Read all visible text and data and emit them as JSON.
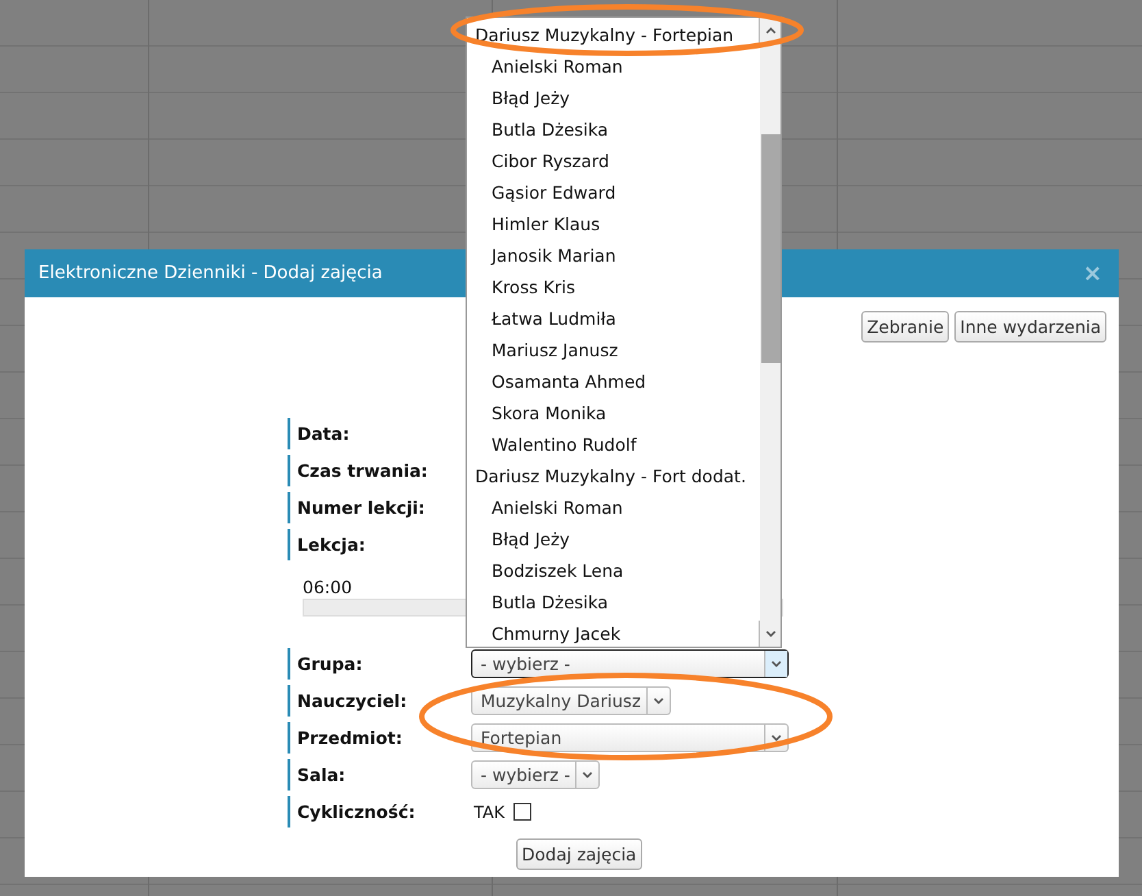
{
  "dialog": {
    "title": "Elektroniczne Dzienniki - Dodaj zajęcia",
    "close": "×",
    "top_buttons": [
      "Zebranie",
      "Inne wydarzenia"
    ],
    "form": [
      {
        "kind": "label",
        "label": "Data:"
      },
      {
        "kind": "label",
        "label": "Czas trwania:"
      },
      {
        "kind": "label",
        "label": "Numer lekcji:"
      },
      {
        "kind": "label",
        "label": "Lekcja:"
      },
      {
        "kind": "timeline",
        "start": "06:00"
      },
      {
        "kind": "select",
        "label": "Grupa:",
        "value": "- wybierz -",
        "focused": true,
        "wide": true
      },
      {
        "kind": "select",
        "label": "Nauczyciel:",
        "value": "Muzykalny Dariusz",
        "focused": false,
        "wide": false
      },
      {
        "kind": "select",
        "label": "Przedmiot:",
        "value": "Fortepian",
        "focused": false,
        "wide": true
      },
      {
        "kind": "select",
        "label": "Sala:",
        "value": "- wybierz -",
        "focused": false,
        "wide": false
      },
      {
        "kind": "checkbox",
        "label": "Cykliczność:",
        "text": "TAK",
        "checked": false
      }
    ],
    "submit": "Dodaj zajęcia"
  },
  "dropdown": {
    "groups": [
      {
        "label": "Dariusz Muzykalny - Fortepian",
        "children": [
          {
            "label": "Anielski Roman"
          },
          {
            "label": "Błąd Jeży"
          },
          {
            "label": "Butla Dżesika"
          },
          {
            "label": "Cibor Ryszard"
          },
          {
            "label": "Gąsior Edward"
          },
          {
            "label": "Himler Klaus"
          },
          {
            "label": "Janosik Marian"
          },
          {
            "label": "Kross Kris"
          },
          {
            "label": "Łatwa Ludmiła"
          },
          {
            "label": "Mariusz Janusz"
          },
          {
            "label": "Osamanta Ahmed"
          },
          {
            "label": "Skora Monika"
          },
          {
            "label": "Walentino Rudolf"
          }
        ]
      },
      {
        "label": "Dariusz Muzykalny - Fort dodat.",
        "children": [
          {
            "label": "Anielski Roman"
          },
          {
            "label": "Błąd Jeży"
          },
          {
            "label": "Bodziszek Lena"
          },
          {
            "label": "Butla Dżesika"
          },
          {
            "label": "Chmurny Jacek"
          }
        ]
      }
    ]
  }
}
